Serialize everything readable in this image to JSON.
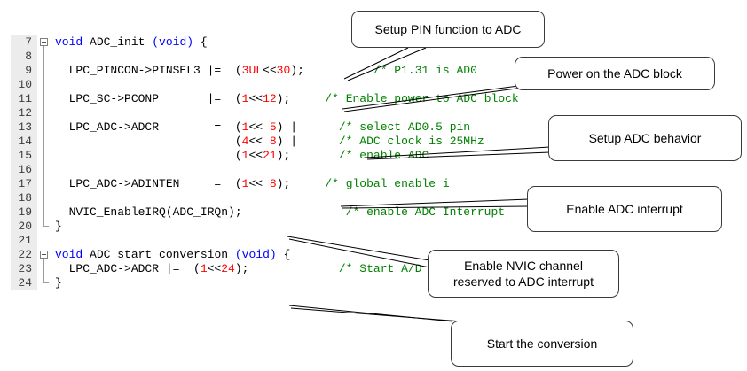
{
  "code_lines": [
    {
      "num": "7",
      "tokens": [
        {
          "t": "void",
          "c": "kw"
        },
        {
          "t": " ADC_init ",
          "c": ""
        },
        {
          "t": "(void)",
          "c": "kw"
        },
        {
          "t": " {",
          "c": ""
        }
      ]
    },
    {
      "num": "8",
      "tokens": []
    },
    {
      "num": "9",
      "tokens": [
        {
          "t": "  LPC_PINCON->PINSEL3 |=  (",
          "c": ""
        },
        {
          "t": "3UL",
          "c": "num"
        },
        {
          "t": "<<",
          "c": ""
        },
        {
          "t": "30",
          "c": "num"
        },
        {
          "t": ");",
          "c": ""
        },
        {
          "t": "          /* P1.31 is AD0",
          "c": "cm"
        }
      ]
    },
    {
      "num": "10",
      "tokens": []
    },
    {
      "num": "11",
      "tokens": [
        {
          "t": "  LPC_SC->PCONP       |=  (",
          "c": ""
        },
        {
          "t": "1",
          "c": "num"
        },
        {
          "t": "<<",
          "c": ""
        },
        {
          "t": "12",
          "c": "num"
        },
        {
          "t": ");",
          "c": ""
        },
        {
          "t": "     /* Enable power to ADC block",
          "c": "cm"
        }
      ]
    },
    {
      "num": "12",
      "tokens": []
    },
    {
      "num": "13",
      "tokens": [
        {
          "t": "  LPC_ADC->ADCR        =  (",
          "c": ""
        },
        {
          "t": "1",
          "c": "num"
        },
        {
          "t": "<< ",
          "c": ""
        },
        {
          "t": "5",
          "c": "num"
        },
        {
          "t": ") |",
          "c": ""
        },
        {
          "t": "      /* select AD0.5 pin",
          "c": "cm"
        }
      ]
    },
    {
      "num": "14",
      "tokens": [
        {
          "t": "                          (",
          "c": ""
        },
        {
          "t": "4",
          "c": "num"
        },
        {
          "t": "<< ",
          "c": ""
        },
        {
          "t": "8",
          "c": "num"
        },
        {
          "t": ") |",
          "c": ""
        },
        {
          "t": "      /* ADC clock is 25MHz",
          "c": "cm"
        }
      ]
    },
    {
      "num": "15",
      "tokens": [
        {
          "t": "                          (",
          "c": ""
        },
        {
          "t": "1",
          "c": "num"
        },
        {
          "t": "<<",
          "c": ""
        },
        {
          "t": "21",
          "c": "num"
        },
        {
          "t": ");",
          "c": ""
        },
        {
          "t": "       /* enable ADC",
          "c": "cm"
        }
      ]
    },
    {
      "num": "16",
      "tokens": []
    },
    {
      "num": "17",
      "tokens": [
        {
          "t": "  LPC_ADC->ADINTEN     =  (",
          "c": ""
        },
        {
          "t": "1",
          "c": "num"
        },
        {
          "t": "<< ",
          "c": ""
        },
        {
          "t": "8",
          "c": "num"
        },
        {
          "t": ");",
          "c": ""
        },
        {
          "t": "     /* global enable i",
          "c": "cm"
        }
      ]
    },
    {
      "num": "18",
      "tokens": []
    },
    {
      "num": "19",
      "tokens": [
        {
          "t": "  NVIC_EnableIRQ(ADC_IRQn);",
          "c": ""
        },
        {
          "t": "               /* enable ADC Interrupt",
          "c": "cm"
        }
      ]
    },
    {
      "num": "20",
      "tokens": [
        {
          "t": "}",
          "c": ""
        }
      ]
    },
    {
      "num": "21",
      "tokens": []
    },
    {
      "num": "22",
      "tokens": [
        {
          "t": "void",
          "c": "kw"
        },
        {
          "t": " ADC_start_conversion ",
          "c": ""
        },
        {
          "t": "(void)",
          "c": "kw"
        },
        {
          "t": " {",
          "c": ""
        }
      ]
    },
    {
      "num": "23",
      "tokens": [
        {
          "t": "  LPC_ADC->ADCR |=  (",
          "c": ""
        },
        {
          "t": "1",
          "c": "num"
        },
        {
          "t": "<<",
          "c": ""
        },
        {
          "t": "24",
          "c": "num"
        },
        {
          "t": ");",
          "c": ""
        },
        {
          "t": "             /* Start A/D Conversion",
          "c": "cm"
        }
      ]
    },
    {
      "num": "24",
      "tokens": [
        {
          "t": "}",
          "c": ""
        }
      ]
    }
  ],
  "callouts": {
    "pin_function": "Setup PIN function to ADC",
    "power": "Power on the ADC block",
    "behavior": "Setup ADC behavior",
    "interrupt": "Enable ADC interrupt",
    "nvic_line1": "Enable NVIC channel",
    "nvic_line2": "reserved to ADC interrupt",
    "start": "Start the conversion"
  },
  "colors": {
    "keyword": "#0000ff",
    "number": "#ff0000",
    "comment": "#008000",
    "gutter": "#ececec"
  }
}
